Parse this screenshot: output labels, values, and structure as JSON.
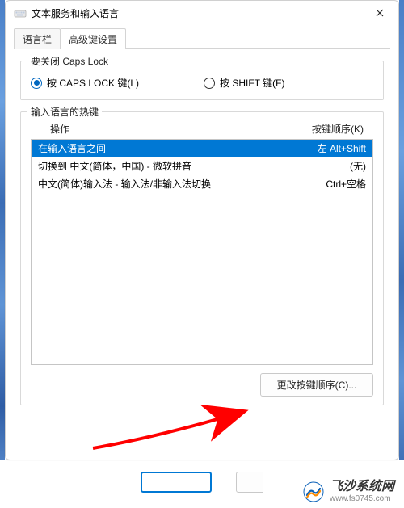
{
  "window": {
    "title": "文本服务和输入语言",
    "close_label": "✕"
  },
  "tabs": [
    {
      "label": "语言栏",
      "active": false
    },
    {
      "label": "高级键设置",
      "active": true
    }
  ],
  "capslock_group": {
    "title": "要关闭 Caps Lock",
    "options": [
      {
        "label": "按 CAPS LOCK 键(L)",
        "selected": true
      },
      {
        "label": "按 SHIFT 键(F)",
        "selected": false
      }
    ]
  },
  "hotkeys_group": {
    "title": "输入语言的热键",
    "columns": {
      "action": "操作",
      "keys": "按键顺序(K)"
    },
    "rows": [
      {
        "action": "在输入语言之间",
        "keys": "左 Alt+Shift",
        "selected": true
      },
      {
        "action": "切换到 中文(简体，中国) - 微软拼音",
        "keys": "(无)",
        "selected": false
      },
      {
        "action": "中文(简体)输入法 - 输入法/非输入法切换",
        "keys": "Ctrl+空格",
        "selected": false
      }
    ],
    "change_button": "更改按键顺序(C)..."
  },
  "watermark": {
    "name": "飞沙系统网",
    "url": "www.fs0745.com"
  },
  "colors": {
    "accent": "#0078d4",
    "selected_bg": "#0078d4",
    "arrow": "#ff0000"
  }
}
